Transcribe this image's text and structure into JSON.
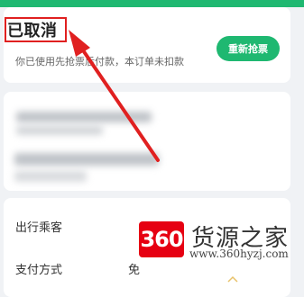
{
  "status": {
    "title": "已取消",
    "description": "你已使用先抢票后付款，本订单未扣款",
    "rebook_button": "重新抢票"
  },
  "details": {
    "passenger_label": "出行乘客",
    "payment_label": "支付方式",
    "payment_value": "免"
  },
  "watermark": {
    "badge": "360",
    "title": "货源之家",
    "url": "www.360hyzj.com"
  },
  "colors": {
    "accent_green": "#1fb871",
    "annotation_red": "#e02020",
    "watermark_red": "#e60012"
  }
}
